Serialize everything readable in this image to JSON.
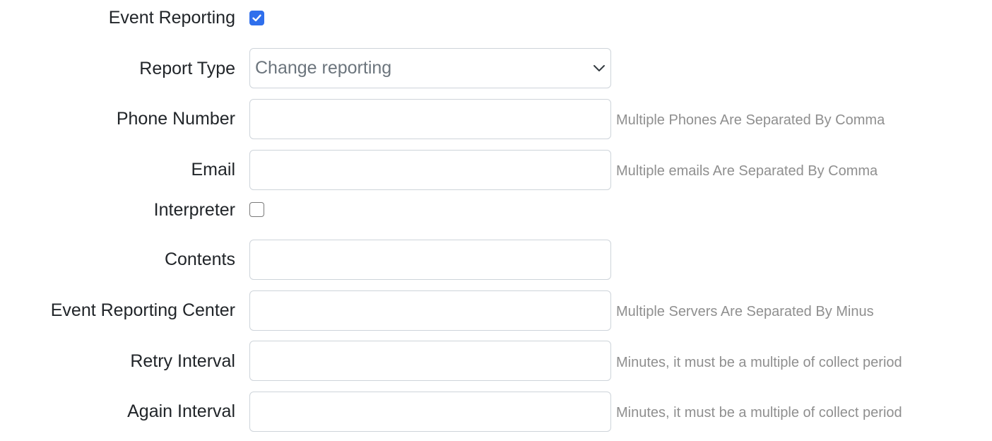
{
  "form": {
    "event_reporting": {
      "label": "Event Reporting",
      "checked": true
    },
    "report_type": {
      "label": "Report Type",
      "selected": "Change reporting"
    },
    "phone_number": {
      "label": "Phone Number",
      "value": "",
      "help": "Multiple Phones Are Separated By Comma"
    },
    "email": {
      "label": "Email",
      "value": "",
      "help": "Multiple emails Are Separated By Comma"
    },
    "interpreter": {
      "label": "Interpreter",
      "checked": false
    },
    "contents": {
      "label": "Contents",
      "value": ""
    },
    "event_reporting_center": {
      "label": "Event Reporting Center",
      "value": "",
      "help": "Multiple Servers Are Separated By Minus"
    },
    "retry_interval": {
      "label": "Retry Interval",
      "value": "",
      "help": "Minutes, it must be a multiple of collect period"
    },
    "again_interval": {
      "label": "Again Interval",
      "value": "",
      "help": "Minutes, it must be a multiple of collect period"
    }
  },
  "colors": {
    "checkbox_checked": "#2f6fec",
    "help_text": "#8f8f8f",
    "border": "#ced4da"
  },
  "icons": {
    "select_arrow": "chevron-down-icon",
    "checkmark": "checkmark-icon"
  }
}
